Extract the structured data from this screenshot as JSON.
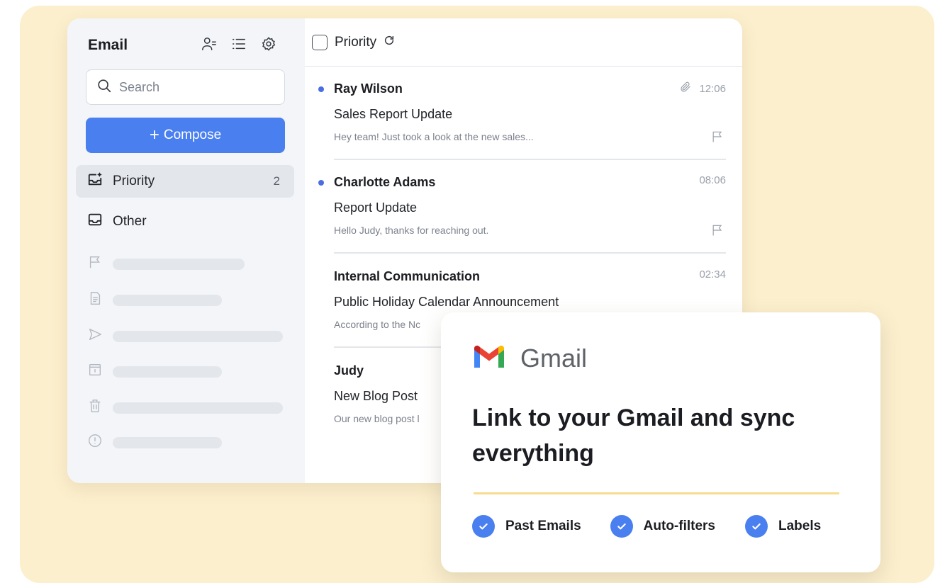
{
  "sidebar": {
    "title": "Email",
    "search_placeholder": "Search",
    "compose_label": "Compose",
    "compose_icon": "+",
    "nav": [
      {
        "label": "Priority",
        "count": "2",
        "icon": "priority-inbox-icon"
      },
      {
        "label": "Other",
        "icon": "inbox-tray-icon"
      }
    ],
    "placeholder_icons": [
      "flag-icon",
      "document-icon",
      "send-icon",
      "archive-icon",
      "trash-icon",
      "alert-icon"
    ]
  },
  "list": {
    "header_label": "Priority",
    "emails": [
      {
        "from": "Ray Wilson",
        "subject": "Sales Report Update",
        "preview": "Hey team! Just took a look at the new sales...",
        "time": "12:06",
        "unread": true,
        "attachment": true
      },
      {
        "from": "Charlotte Adams",
        "subject": "Report Update",
        "preview": "Hello Judy, thanks for reaching out.",
        "time": "08:06",
        "unread": true,
        "attachment": false
      },
      {
        "from": "Internal Communication",
        "subject": "Public Holiday Calendar Announcement",
        "preview": "According to the Nc",
        "time": "02:34",
        "unread": false,
        "attachment": false
      },
      {
        "from": "Judy",
        "subject": "New Blog Post",
        "preview": "Our new blog post l",
        "time": "",
        "unread": false,
        "attachment": false
      }
    ]
  },
  "gmail_card": {
    "brand": "Gmail",
    "headline": "Link to your Gmail and sync everything",
    "features": [
      "Past Emails",
      "Auto-filters",
      "Labels"
    ]
  },
  "colors": {
    "background": "#fcefcd",
    "accent": "#4a7ff0",
    "divider": "#f7dc8e"
  }
}
